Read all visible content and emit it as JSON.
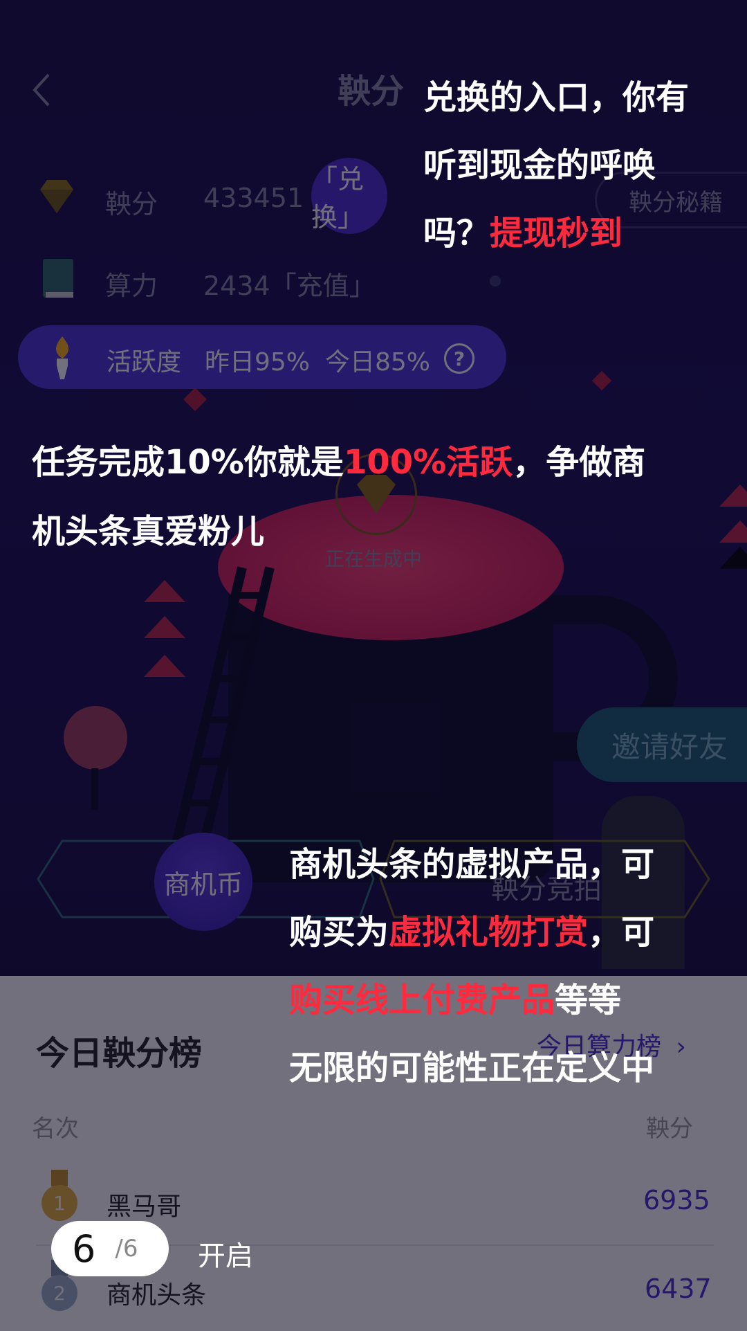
{
  "header": {
    "title": "鞅分",
    "back_icon": "chevron-left-icon"
  },
  "assets": [
    {
      "label": "鞅分",
      "value": "433451",
      "icon": "diamond-icon"
    },
    {
      "label": "算力",
      "value": "2434「充值」",
      "icon": "book-icon"
    }
  ],
  "exchange_button": "「兑换」",
  "secret_button": "鞅分秘籍",
  "activity": {
    "label": "活跃度",
    "yesterday": "昨日95%",
    "today": "今日85%",
    "help_icon": "?"
  },
  "generating_text": "正在生成中",
  "invite_button": "邀请好友",
  "coin_button": "商机币",
  "auction_button": "鞅分竞拍",
  "leaderboard": {
    "title": "今日鞅分榜",
    "link": "今日算力榜",
    "col_rank": "名次",
    "col_score": "鞅分",
    "rows": [
      {
        "rank": "1",
        "name": "黑马哥",
        "score": "6935"
      },
      {
        "rank": "2",
        "name": "商机头条",
        "score": "6437"
      }
    ]
  },
  "overlay": {
    "caption1": {
      "line1": "兑换的入口，你有",
      "line2": "听到现金的呼唤",
      "line3_white": "吗？",
      "line3_red": "提现秒到"
    },
    "caption2": {
      "line1_white_a": "任务完成10%你就是",
      "line1_red": "100%活跃",
      "line1_white_b": "，争做商",
      "line2": "机头条真爱粉儿"
    },
    "caption3": {
      "line1": "商机头条的虚拟产品，可",
      "line2_white_a": "购买为",
      "line2_red": "虚拟礼物打赏",
      "line2_white_b": "，可",
      "line3_red": "购买线上付费产品",
      "line3_white": "等等",
      "line4": "无限的可能性正在定义中"
    },
    "pager_current": "6",
    "pager_total": "/6",
    "open_label": "开启"
  }
}
